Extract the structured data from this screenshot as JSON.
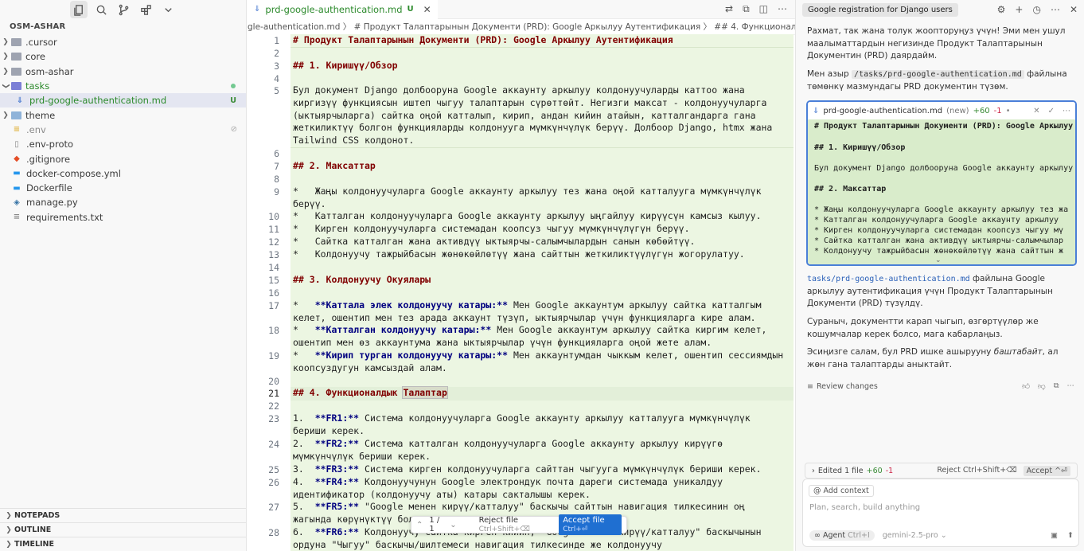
{
  "sidebar": {
    "project_title": "OSM-ASHAR",
    "items": [
      {
        "label": ".cursor",
        "type": "folder"
      },
      {
        "label": "core",
        "type": "folder"
      },
      {
        "label": "osm-ashar",
        "type": "folder"
      },
      {
        "label": "tasks",
        "type": "folder",
        "open": true
      },
      {
        "label": "prd-google-authentication.md",
        "type": "md",
        "status": "U"
      },
      {
        "label": "theme",
        "type": "folder"
      },
      {
        "label": ".env",
        "type": "env"
      },
      {
        "label": ".env-proto",
        "type": "file"
      },
      {
        "label": ".gitignore",
        "type": "git"
      },
      {
        "label": "docker-compose.yml",
        "type": "docker"
      },
      {
        "label": "Dockerfile",
        "type": "docker"
      },
      {
        "label": "manage.py",
        "type": "python"
      },
      {
        "label": "requirements.txt",
        "type": "text"
      }
    ],
    "status_u": "U",
    "panels": [
      "NOTEPADS",
      "OUTLINE",
      "TIMELINE"
    ]
  },
  "editor": {
    "tab_title": "prd-google-authentication.md",
    "tab_status": "U",
    "breadcrumb": "gle-authentication.md  〉 # Продукт Талаптарынын Документи (PRD): Google Аркылуу Аутентификация  〉 ## 4. Функционалдык",
    "line_numbers": [
      "1",
      "2",
      "3",
      "4",
      "5",
      "6",
      "7",
      "8",
      "9",
      "10",
      "11",
      "12",
      "13",
      "14",
      "15",
      "16",
      "17",
      "18",
      "19",
      "20",
      "21",
      "22",
      "23",
      "24",
      "25",
      "26",
      "27",
      "28"
    ],
    "lines": {
      "l1": "# Продукт Талаптарынын Документи (PRD): Google Аркылуу Аутентификация",
      "l3": "## 1. Киришүү/Обзор",
      "l5": "Бул документ Django долбооруна Google аккаунту аркылуу колдонуучуларды каттоо жана киргизүү функциясын иштеп чыгуу талаптарын сүрөттөйт. Негизги максат - колдонуучуларга (ыктыярчыларга) сайтка оңой катталып, кирип, андан кийин атайын, катталгандарга гана жеткиликтүү болгон функцияларды колдонууга мүмкүнчүлүк берүү. Долбоор Django, htmx жана Tailwind CSS колдонот.",
      "l7": "## 2. Максаттар",
      "l9": "*   Жаңы колдонуучуларга Google аккаунту аркылуу тез жана оңой катталууга мүмкүнчүлүк берүү.",
      "l10": "*   Катталган колдонуучуларга Google аккаунту аркылуу ыңгайлуу кирүүсүн камсыз кылуу.",
      "l11": "*   Кирген колдонуучуларга системадан коопсуз чыгуу мүмкүнчүлүгүн берүү.",
      "l12": "*   Сайтка катталган жана активдүү ыктыярчы-салымчылардын санын көбөйтүү.",
      "l13": "*   Колдонуучу тажрыйбасын жөнөкөйлөтүү жана сайттын жеткиликтүүлүгүн жогорулатуу.",
      "l15": "## 3. Колдонуучу Окуялары",
      "l17a": "**Каттала элек колдонуучу катары:**",
      "l17b": " Мен Google аккаунтум аркылуу сайтка катталгым келет, ошентип мен тез арада аккаунт түзүп, ыктыярчылар үчүн функцияларга кире алам.",
      "l18a": "**Катталган колдонуучу катары:**",
      "l18b": " Мен Google аккаунтум аркылуу сайтка киргим келет, ошентип мен өз аккаунтума жана ыктыярчылар үчүн функцияларга оңой жете алам.",
      "l19a": "**Кирип турган колдонуучу катары:**",
      "l19b": " Мен аккаунтумдан чыккым келет, ошентип сессиямдын коопсуздугун камсыздай алам.",
      "l21a": "## 4. Функционалдык ",
      "l21b": "Талаптар",
      "l23a": "**FR1:**",
      "l23b": " Система колдонуучуларга Google аккаунту аркылуу катталууга мүмкүнчүлүк бериши керек.",
      "l24a": "**FR2:**",
      "l24b": " Система катталган колдонуучуларга Google аккаунту аркылуу кирүүгө мүмкүнчүлүк бериши керек.",
      "l25a": "**FR3:**",
      "l25b": " Система кирген колдонуучуларга сайттан чыгууга мүмкүнчүлүк бериши керек.",
      "l26a": "**FR4:**",
      "l26b": " Колдонуучунун Google электрондук почта дареги системада уникалдуу идентификатор (колдонуучу аты) катары сакталышы керек.",
      "l27a": "**FR5:**",
      "l27b": " \"Google менен кирүү/катталуу\" баскычы сайттын навигация тилкесинин оң жагында көрүнүктүү болушу керек.",
      "l28a": "**FR6:**",
      "l28b": " Колдонуучу сайтка кирген кийин, \"Google менен кирүү/катталуу\" баскычынын ордуна \"Чыгуу\" баскычы/шилтемеси навигация тилкесинде же колдонуучу"
    },
    "popup": {
      "counter": "1 / 1",
      "reject": "Reject file",
      "reject_key": "Ctrl+Shift+⌫",
      "accept": "Accept file",
      "accept_key": "Ctrl+⏎"
    }
  },
  "chat": {
    "title": "Google registration for Django users",
    "p1": "Рахмат, так жана толук жоопторуңуз үчүн! Эми мен ушул маалыматтардын негизинде Продукт Талаптарынын Документин (PRD) даярдайм.",
    "p2_pre": "Мен азыр ",
    "p2_code": "/tasks/prd-google-authentication.md",
    "p2_post": " файлына төмөнкү мазмундагы PRD документин түзөм.",
    "diff": {
      "file": "prd-google-authentication.md",
      "new": "(new)",
      "plus": "+60",
      "minus": "-1",
      "lines": [
        "# Продукт Талаптарынын Документи (PRD): Google Аркылуу",
        "## 1. Киришүү/Обзор",
        "Бул документ Django долбооруна Google аккаунту аркылуу",
        "## 2. Максаттар",
        "*   Жаңы колдонуучуларга Google аккаунту аркылуу тез жа",
        "*   Катталган колдонуучуларга Google аккаунту аркылуу",
        "*   Кирген колдонуучуларга системадан коопсуз чыгуу мү",
        "*   Сайтка катталган жана активдүү ыктыярчы-салымчылар",
        "*   Колдонуучу тажрыйбасын жөнөкөйлөтүү жана сайттын ж"
      ]
    },
    "p3_path": "tasks/prd-google-authentication.md",
    "p3_text": " файлына Google аркылуу аутентификация үчүн Продукт Талаптарынын Документи (PRD) түзүлдү.",
    "p4": "Сураныч, документти карап чыгып, өзгөртүүлөр же кошумчалар керек болсо, мага кабарлаңыз.",
    "p5_pre": "Эсиңизге салам, бул PRD ишке ашырууну ",
    "p5_em": "баштабайт",
    "p5_post": ", ал жөн гана талаптарды аныктайт.",
    "review": "Review changes",
    "edited": {
      "label": "Edited 1 file",
      "plus": "+60",
      "minus": "-1",
      "reject": "Reject Ctrl+Shift+⌫",
      "accept": "Accept ^⏎"
    },
    "input": {
      "add_context": "Add context",
      "placeholder": "Plan, search, build anything",
      "agent": "Agent",
      "agent_key": "Ctrl+I",
      "model": "gemini-2.5-pro"
    }
  }
}
